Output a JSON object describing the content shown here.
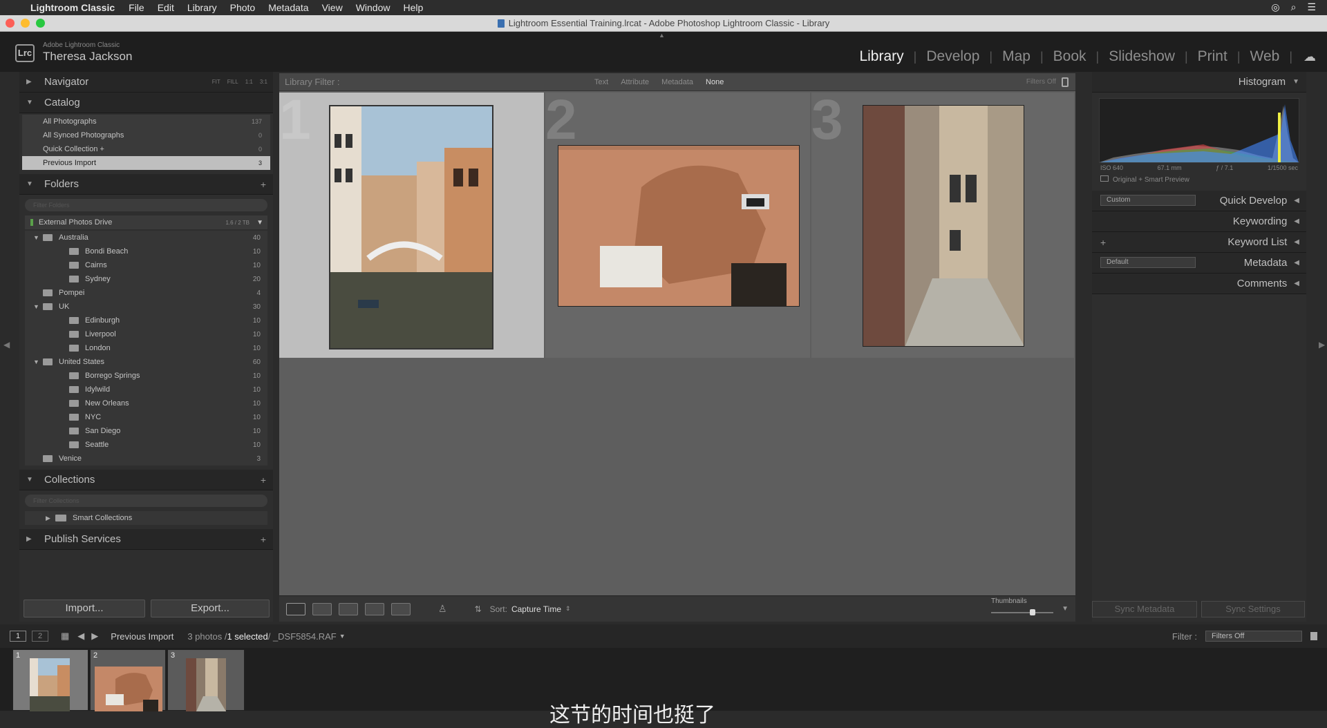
{
  "os_menu": {
    "app": "Lightroom Classic",
    "items": [
      "File",
      "Edit",
      "Library",
      "Photo",
      "Metadata",
      "View",
      "Window",
      "Help"
    ]
  },
  "window": {
    "title": "Lightroom Essential Training.lrcat - Adobe Photoshop Lightroom Classic - Library"
  },
  "identity": {
    "logo": "Lrc",
    "product": "Adobe Lightroom Classic",
    "user": "Theresa Jackson"
  },
  "modules": [
    "Library",
    "Develop",
    "Map",
    "Book",
    "Slideshow",
    "Print",
    "Web"
  ],
  "active_module": "Library",
  "left_panel": {
    "navigator": {
      "title": "Navigator",
      "zoom_options": [
        "FIT",
        "FILL",
        "1:1",
        "3:1"
      ]
    },
    "catalog": {
      "title": "Catalog",
      "items": [
        {
          "label": "All Photographs",
          "count": "137"
        },
        {
          "label": "All Synced Photographs",
          "count": "0"
        },
        {
          "label": "Quick Collection +",
          "count": "0"
        },
        {
          "label": "Previous Import",
          "count": "3",
          "selected": true
        }
      ]
    },
    "folders": {
      "title": "Folders",
      "filter_placeholder": "Filter Folders",
      "volume": {
        "name": "External Photos Drive",
        "size": "1.6 / 2 TB"
      },
      "tree": [
        {
          "label": "Australia",
          "count": "40",
          "level": 0,
          "expanded": true
        },
        {
          "label": "Bondi Beach",
          "count": "10",
          "level": 1
        },
        {
          "label": "Cairns",
          "count": "10",
          "level": 1
        },
        {
          "label": "Sydney",
          "count": "20",
          "level": 1
        },
        {
          "label": "Pompei",
          "count": "4",
          "level": 0
        },
        {
          "label": "UK",
          "count": "30",
          "level": 0,
          "expanded": true
        },
        {
          "label": "Edinburgh",
          "count": "10",
          "level": 1
        },
        {
          "label": "Liverpool",
          "count": "10",
          "level": 1
        },
        {
          "label": "London",
          "count": "10",
          "level": 1
        },
        {
          "label": "United States",
          "count": "60",
          "level": 0,
          "expanded": true
        },
        {
          "label": "Borrego Springs",
          "count": "10",
          "level": 1
        },
        {
          "label": "Idylwild",
          "count": "10",
          "level": 1
        },
        {
          "label": "New Orleans",
          "count": "10",
          "level": 1
        },
        {
          "label": "NYC",
          "count": "10",
          "level": 1
        },
        {
          "label": "San Diego",
          "count": "10",
          "level": 1
        },
        {
          "label": "Seattle",
          "count": "10",
          "level": 1
        },
        {
          "label": "Venice",
          "count": "3",
          "level": 0
        }
      ]
    },
    "collections": {
      "title": "Collections",
      "filter_placeholder": "Filter Collections",
      "items": [
        "Smart Collections"
      ]
    },
    "publish": {
      "title": "Publish Services"
    },
    "import_label": "Import...",
    "export_label": "Export..."
  },
  "library_filter": {
    "label": "Library Filter :",
    "options": [
      "Text",
      "Attribute",
      "Metadata",
      "None"
    ],
    "active": "None",
    "status": "Filters Off"
  },
  "grid": {
    "cells": [
      {
        "num": "1"
      },
      {
        "num": "2"
      },
      {
        "num": "3"
      }
    ]
  },
  "toolbar": {
    "sort_label": "Sort:",
    "sort_value": "Capture Time",
    "thumbnails_label": "Thumbnails"
  },
  "right_panel": {
    "histogram": {
      "title": "Histogram",
      "iso": "ISO 640",
      "focal": "67.1 mm",
      "aperture": "ƒ / 7.1",
      "shutter": "1/1500 sec",
      "preview": "Original + Smart Preview"
    },
    "quick_develop": {
      "title": "Quick Develop",
      "preset": "Custom"
    },
    "keywording": {
      "title": "Keywording"
    },
    "keyword_list": {
      "title": "Keyword List"
    },
    "metadata": {
      "title": "Metadata",
      "preset": "Default"
    },
    "comments": {
      "title": "Comments"
    },
    "sync_metadata": "Sync Metadata",
    "sync_settings": "Sync Settings"
  },
  "status_bar": {
    "pages": [
      "1",
      "2"
    ],
    "source": "Previous Import",
    "count_text": "3 photos / ",
    "selected_text": "1 selected",
    "file_text": " / _DSF5854.RAF",
    "filter_label": "Filter :",
    "filter_value": "Filters Off"
  },
  "filmstrip": {
    "thumbs": [
      {
        "num": "1"
      },
      {
        "num": "2"
      },
      {
        "num": "3"
      }
    ]
  },
  "subtitle": "这节的时间也挺了",
  "colors": {
    "accent": "#bfbfbf",
    "panel": "#2e2e2e",
    "grid": "#5e5e5e"
  }
}
